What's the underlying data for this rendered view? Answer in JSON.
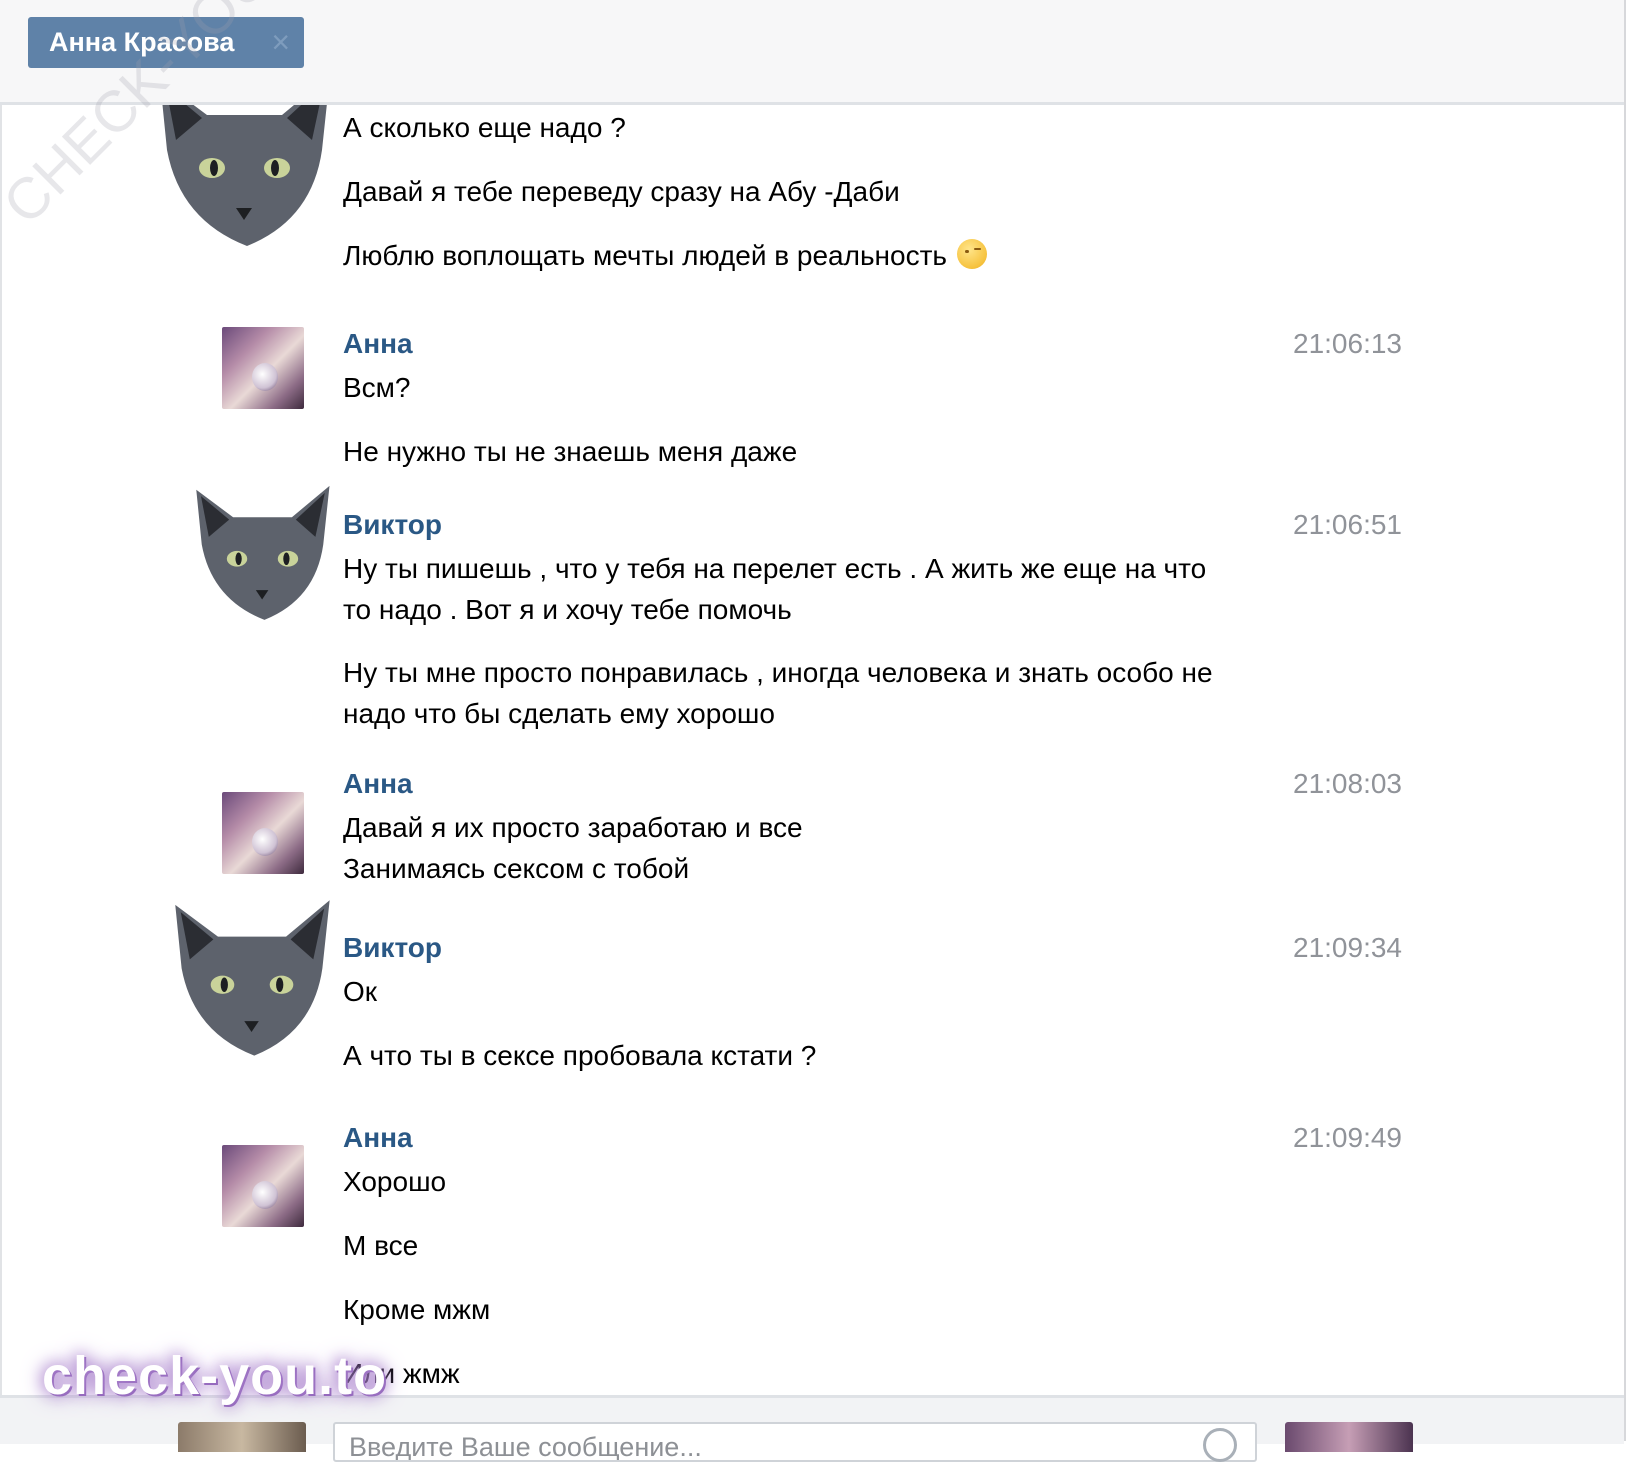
{
  "tab": {
    "title": "Анна Красова",
    "close_symbol": "×"
  },
  "messages": [
    {
      "lines": [
        "А сколько еще надо ?"
      ]
    },
    {
      "lines": [
        "Давай я тебе переведу сразу на Абу -Даби"
      ]
    },
    {
      "lines": [
        "Люблю воплощать мечты людей в реальность"
      ],
      "emoji": "wink-emoji"
    },
    {
      "name": "Анна",
      "time": "21:06:13"
    },
    {
      "lines": [
        "Всм?"
      ]
    },
    {
      "lines": [
        "Не нужно ты не знаешь меня даже"
      ]
    },
    {
      "name": "Виктор",
      "time": "21:06:51"
    },
    {
      "lines": [
        "Ну ты пишешь , что у тебя на перелет есть . А жить же еще на что",
        "то надо . Вот я и хочу тебе помочь"
      ]
    },
    {
      "lines": [
        "Ну ты мне просто понравилась , иногда человека и знать особо не",
        "надо что бы сделать ему хорошо"
      ]
    },
    {
      "name": "Анна",
      "time": "21:08:03"
    },
    {
      "lines": [
        "Давай я их просто заработаю и все",
        "Занимаясь сексом с тобой"
      ]
    },
    {
      "name": "Виктор",
      "time": "21:09:34"
    },
    {
      "lines": [
        "Ок"
      ]
    },
    {
      "lines": [
        "А что ты в сексе пробовала кстати ?"
      ]
    },
    {
      "name": "Анна",
      "time": "21:09:49"
    },
    {
      "lines": [
        "Хорошо"
      ]
    },
    {
      "lines": [
        "М все"
      ]
    },
    {
      "lines": [
        "Кроме мжм"
      ]
    },
    {
      "lines": [
        "Или жмж"
      ]
    }
  ],
  "composer": {
    "placeholder": "Введите Ваше сообщение..."
  },
  "watermarks": {
    "logo": "check-you.to",
    "diagonal": "CHECK-YOU.ME"
  },
  "colors": {
    "tab_bg": "#5f82a8",
    "name": "#2a5885",
    "time": "#909399",
    "logo_glow": "#9b6fc4"
  }
}
